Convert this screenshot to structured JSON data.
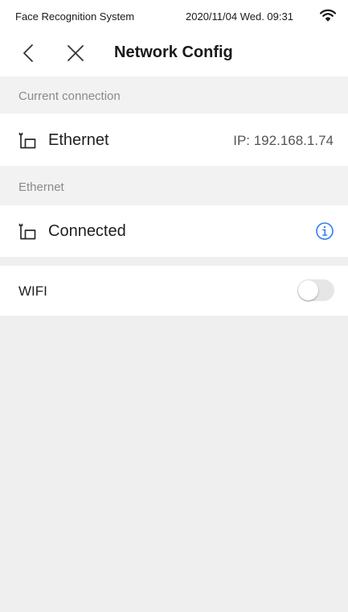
{
  "status_bar": {
    "app_name": "Face Recognition System",
    "datetime": "2020/11/04  Wed.  09:31",
    "wifi_icon": "wifi-icon"
  },
  "nav": {
    "back_icon": "chevron-left-icon",
    "close_icon": "close-icon",
    "title": "Network Config"
  },
  "current_connection": {
    "header": "Current connection",
    "type_label": "Ethernet",
    "ip_text": "IP:  192.168.1.74",
    "icon": "ethernet-plug-icon"
  },
  "ethernet": {
    "header": "Ethernet",
    "status_label": "Connected",
    "icon": "ethernet-plug-icon",
    "info_icon": "info-icon"
  },
  "wifi": {
    "label": "WIFI",
    "enabled": false
  },
  "colors": {
    "accent": "#2f7cf6",
    "background": "#efefef",
    "row": "#ffffff",
    "muted_text": "#8a8a8a"
  }
}
